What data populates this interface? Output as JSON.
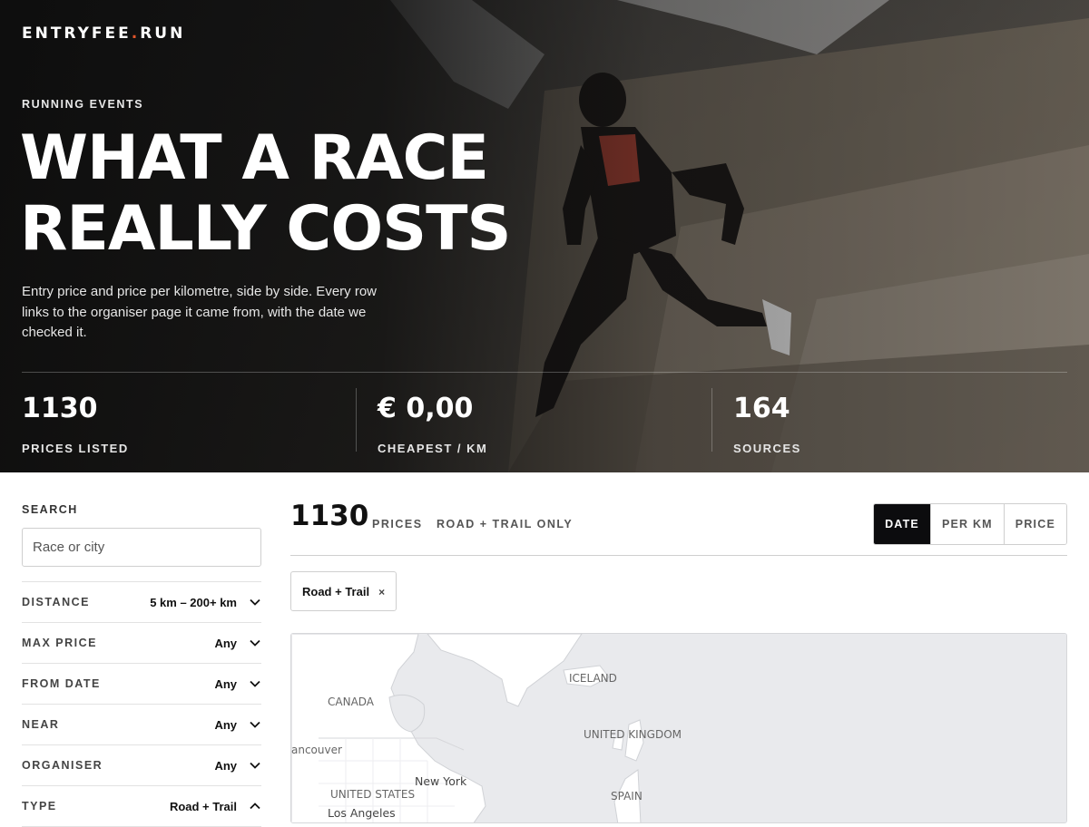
{
  "brand": {
    "name_part1": "ENTRYFEE",
    "dot": ".",
    "name_part2": "RUN",
    "accent_color": "#e2552b"
  },
  "hero": {
    "eyebrow": "RUNNING EVENTS",
    "headline_line1": "WHAT A RACE",
    "headline_line2": "REALLY COSTS",
    "lede": "Entry price and price per kilometre, side by side. Every row links to the organiser page it came from, with the date we checked it.",
    "image": "trail-runner-mountain-photo"
  },
  "stats": [
    {
      "value": "1130",
      "label": "PRICES LISTED"
    },
    {
      "value": "€ 0,00",
      "label": "CHEAPEST / KM"
    },
    {
      "value": "164",
      "label": "SOURCES"
    }
  ],
  "sidebar": {
    "search_label": "SEARCH",
    "search_placeholder": "Race or city",
    "filters": [
      {
        "label": "DISTANCE",
        "value": "5 km – 200+ km",
        "expanded": false
      },
      {
        "label": "MAX PRICE",
        "value": "Any",
        "expanded": false
      },
      {
        "label": "FROM DATE",
        "value": "Any",
        "expanded": false
      },
      {
        "label": "NEAR",
        "value": "Any",
        "expanded": false
      },
      {
        "label": "ORGANISER",
        "value": "Any",
        "expanded": false
      },
      {
        "label": "TYPE",
        "value": "Road + Trail",
        "expanded": true
      }
    ]
  },
  "results": {
    "count": "1130",
    "count_unit": "PRICES",
    "scope": "ROAD + TRAIL ONLY",
    "sort_options": [
      {
        "label": "DATE",
        "active": true
      },
      {
        "label": "PER KM",
        "active": false
      },
      {
        "label": "PRICE",
        "active": false
      }
    ],
    "active_chip": {
      "label": "Road + Trail",
      "remove": "×"
    }
  },
  "map": {
    "labels": {
      "canada": "CANADA",
      "vancouver": "ancouver",
      "united_states": "UNITED STATES",
      "new_york": "New York",
      "los_angeles": "Los Angeles",
      "iceland": "ICELAND",
      "united_kingdom": "UNITED KINGDOM",
      "spain": "SPAIN"
    }
  }
}
